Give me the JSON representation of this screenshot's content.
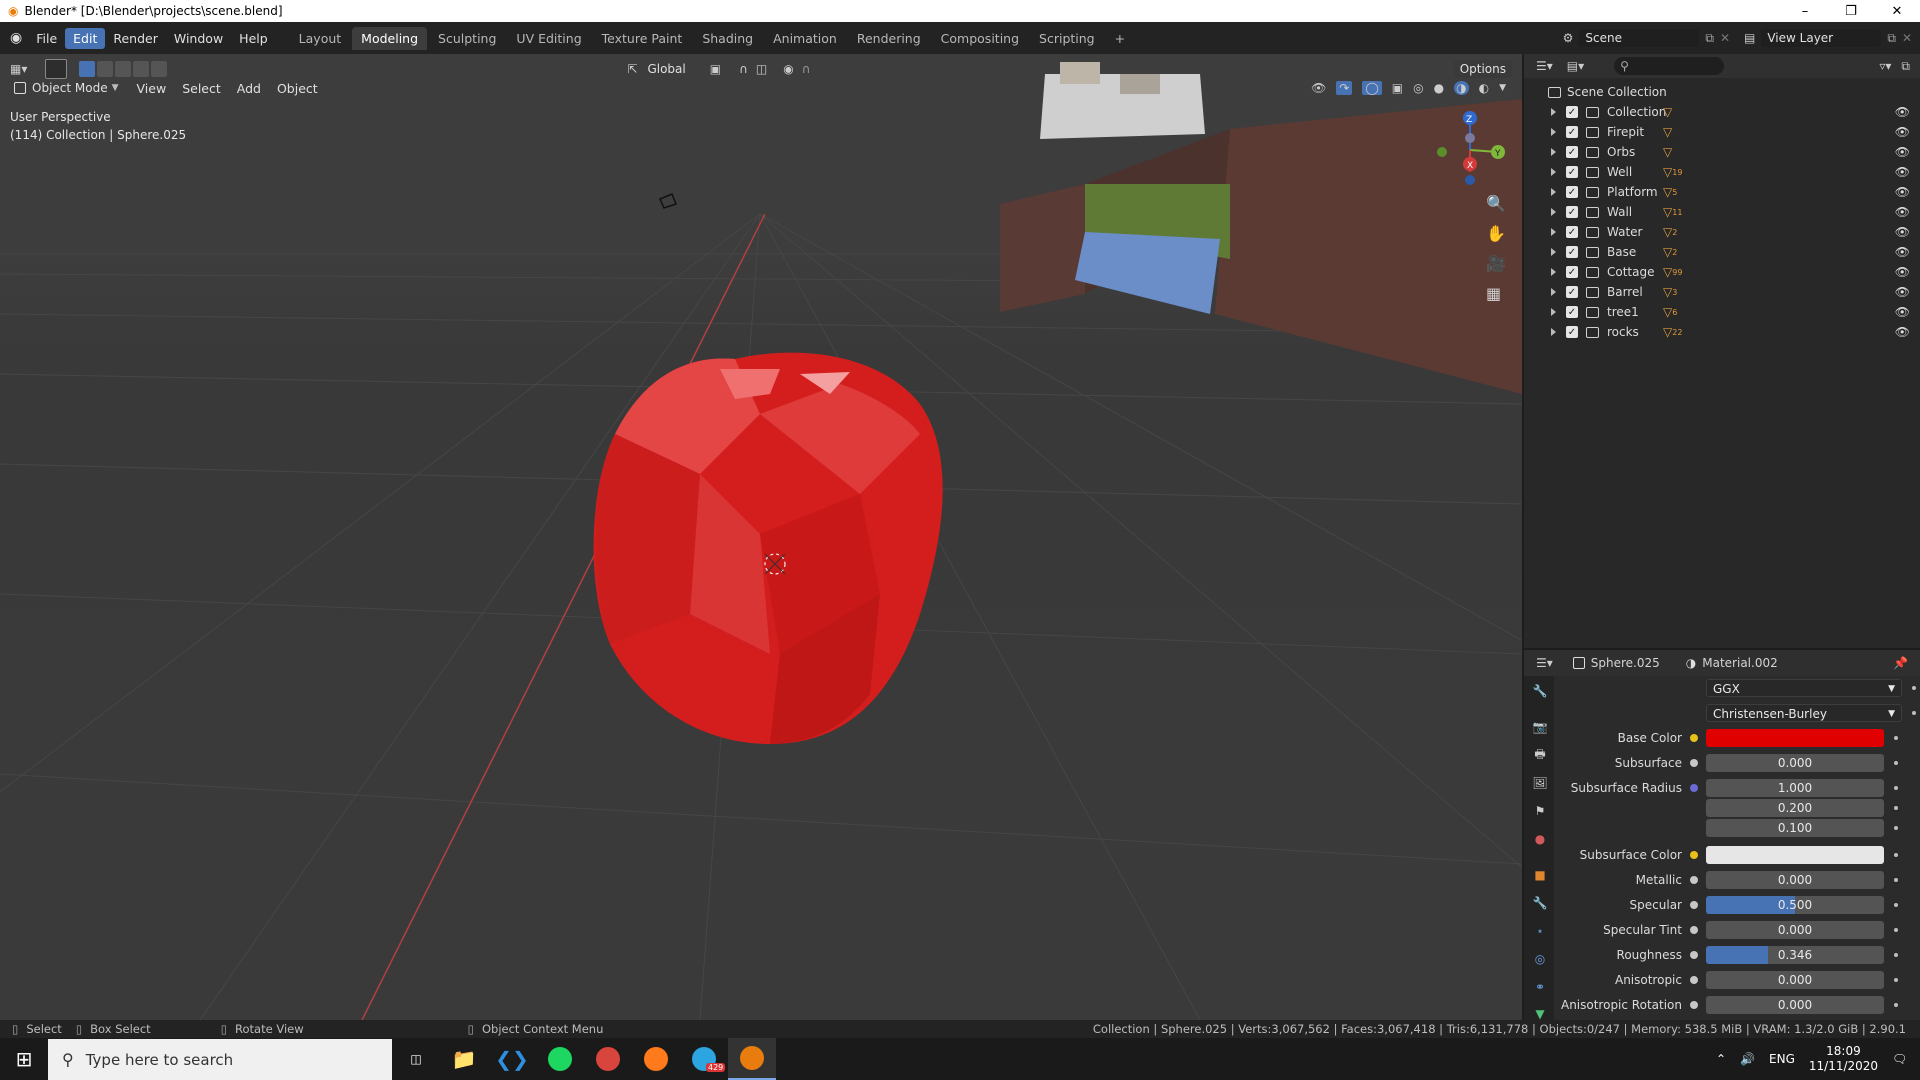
{
  "window": {
    "title": "Blender* [D:\\Blender\\projects\\scene.blend]",
    "controls": [
      "–",
      "❐",
      "✕"
    ]
  },
  "menu": {
    "items": [
      "File",
      "Edit",
      "Render",
      "Window",
      "Help"
    ],
    "active": "Edit"
  },
  "workspaces": {
    "tabs": [
      "Layout",
      "Modeling",
      "Sculpting",
      "UV Editing",
      "Texture Paint",
      "Shading",
      "Animation",
      "Rendering",
      "Compositing",
      "Scripting"
    ],
    "active": "Modeling",
    "add": "+"
  },
  "scene": {
    "name": "Scene",
    "view_layer": "View Layer"
  },
  "viewport": {
    "mode": "Object Mode",
    "menus": [
      "View",
      "Select",
      "Add",
      "Object"
    ],
    "transform_orientation": "Global",
    "options_label": "Options",
    "info_line1": "User Perspective",
    "info_line2": "(114) Collection | Sphere.025",
    "gizmo": {
      "z": "Z",
      "y": "Y",
      "x": "X"
    }
  },
  "outliner": {
    "root": "Scene Collection",
    "items": [
      {
        "name": "Collection",
        "badge": ""
      },
      {
        "name": "Firepit",
        "badge": ""
      },
      {
        "name": "Orbs",
        "badge": ""
      },
      {
        "name": "Well",
        "badge": "19"
      },
      {
        "name": "Platform",
        "badge": "5"
      },
      {
        "name": "Wall",
        "badge": "11"
      },
      {
        "name": "Water",
        "badge": "2"
      },
      {
        "name": "Base",
        "badge": "2"
      },
      {
        "name": "Cottage",
        "badge": "99"
      },
      {
        "name": "Barrel",
        "badge": "3"
      },
      {
        "name": "tree1",
        "badge": "6"
      },
      {
        "name": "rocks",
        "badge": "22"
      }
    ]
  },
  "properties": {
    "object": "Sphere.025",
    "material": "Material.002",
    "distribution": "GGX",
    "subsurface_method": "Christensen-Burley",
    "rows": [
      {
        "label": "Base Color",
        "kind": "color",
        "color": "#e00000",
        "dot": "#e8c21a"
      },
      {
        "label": "Subsurface",
        "kind": "num",
        "value": "0.000",
        "fill": 0,
        "dot": "#c7c7c7"
      },
      {
        "label": "Subsurface Radius",
        "kind": "num",
        "value": "1.000",
        "fill": 0,
        "dot": "#6b6bd6"
      },
      {
        "label": "",
        "kind": "num",
        "value": "0.200",
        "fill": 0,
        "dot": ""
      },
      {
        "label": "",
        "kind": "num",
        "value": "0.100",
        "fill": 0,
        "dot": ""
      },
      {
        "label": "Subsurface Color",
        "kind": "color",
        "color": "#e6e6e6",
        "dot": "#e8c21a"
      },
      {
        "label": "Metallic",
        "kind": "num",
        "value": "0.000",
        "fill": 0,
        "dot": "#c7c7c7"
      },
      {
        "label": "Specular",
        "kind": "num",
        "value": "0.500",
        "fill": 0.5,
        "dot": "#c7c7c7"
      },
      {
        "label": "Specular Tint",
        "kind": "num",
        "value": "0.000",
        "fill": 0,
        "dot": "#c7c7c7"
      },
      {
        "label": "Roughness",
        "kind": "num",
        "value": "0.346",
        "fill": 0.346,
        "dot": "#c7c7c7"
      },
      {
        "label": "Anisotropic",
        "kind": "num",
        "value": "0.000",
        "fill": 0,
        "dot": "#c7c7c7"
      },
      {
        "label": "Anisotropic Rotation",
        "kind": "num",
        "value": "0.000",
        "fill": 0,
        "dot": "#c7c7c7"
      }
    ]
  },
  "statusbar": {
    "hints": [
      "Select",
      "Box Select",
      "Rotate View",
      "Object Context Menu"
    ],
    "stats": "Collection | Sphere.025 | Verts:3,067,562 | Faces:3,067,418 | Tris:6,131,778 | Objects:0/247 | Memory: 538.5 MiB | VRAM: 1.3/2.0 GiB | 2.90.1"
  },
  "taskbar": {
    "search_placeholder": "Type here to search",
    "telegram_badge": "429",
    "language": "ENG",
    "time": "18:09",
    "date": "11/11/2020"
  },
  "colors": {
    "accent": "#4772b3",
    "apple": "#d41e1e",
    "x_axis": "#c13a3a"
  }
}
